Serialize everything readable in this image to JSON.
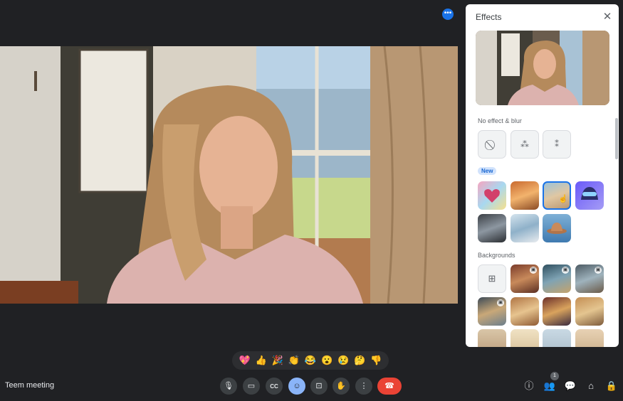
{
  "meeting": {
    "name": "Teem meeting"
  },
  "effects_panel": {
    "title": "Effects",
    "sections": {
      "no_effect": "No effect & blur",
      "new_badge": "New",
      "backgrounds": "Backgrounds"
    }
  },
  "reactions": [
    "💖",
    "👍",
    "🎉",
    "👏",
    "😂",
    "😮",
    "😢",
    "🤔",
    "👎"
  ],
  "participants": {
    "count": "1"
  },
  "colors": {
    "accent": "#1a73e8",
    "end_call": "#ea4335",
    "active_control": "#8ab4f8",
    "background": "#202124"
  },
  "icons": {
    "more": "more-options-icon",
    "close": "close-icon",
    "mic": "microphone-icon",
    "camera": "camera-icon",
    "captions": "closed-captions-icon",
    "emoji": "emoji-icon",
    "present": "present-screen-icon",
    "raise_hand": "raise-hand-icon",
    "more_vert": "more-vertical-icon",
    "end_call": "end-call-icon",
    "info": "info-icon",
    "people": "people-icon",
    "chat": "chat-icon",
    "activities": "activities-icon",
    "host_controls": "host-controls-lock-icon"
  }
}
